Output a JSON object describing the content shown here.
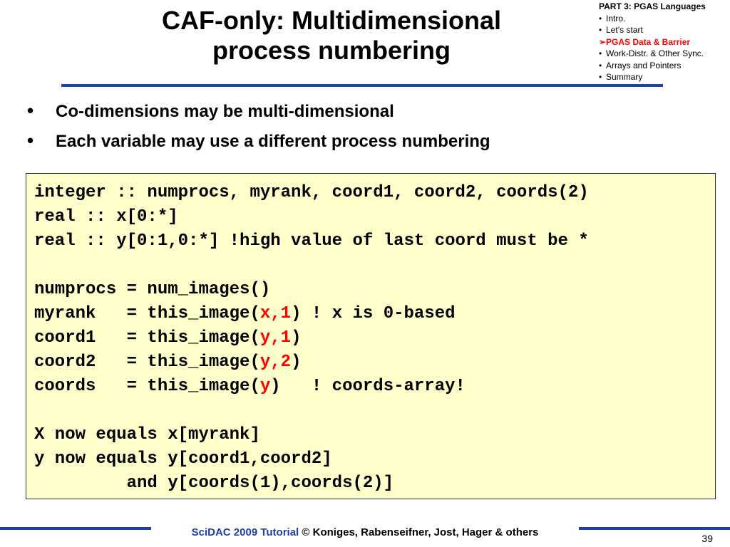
{
  "title": {
    "line1": "CAF-only:  Multidimensional",
    "line2": "process numbering"
  },
  "outline": {
    "heading": "PART 3: PGAS Languages",
    "items": [
      {
        "label": "Intro.",
        "marker": "•",
        "current": false
      },
      {
        "label": "Let’s start",
        "marker": "•",
        "current": false
      },
      {
        "label": "PGAS Data & Barrier",
        "marker": "➢",
        "current": true
      },
      {
        "label": "Work-Distr. & Other Sync.",
        "marker": "•",
        "current": false
      },
      {
        "label": "Arrays and Pointers",
        "marker": "•",
        "current": false
      },
      {
        "label": "Summary",
        "marker": "•",
        "current": false
      }
    ]
  },
  "bullets": [
    "Co-dimensions may be multi-dimensional",
    "Each variable may use a different process numbering"
  ],
  "code": {
    "line1": "integer :: numprocs, myrank, coord1, coord2, coords(2)",
    "line2": "real :: x[0:*]",
    "line3": "real :: y[0:1,0:*] !high value of last coord must be *",
    "line5": "numprocs = num_images()",
    "line6": {
      "pre": "myrank   = this_image(",
      "hl": "x,1",
      "post": ") ! x is 0-based"
    },
    "line7": {
      "pre": "coord1   = this_image(",
      "hl": "y,1",
      "post": ")"
    },
    "line8": {
      "pre": "coord2   = this_image(",
      "hl": "y,2",
      "post": ")"
    },
    "line9": {
      "pre": "coords   = this_image(",
      "hl": "y",
      "post": ")   ! coords-array!"
    },
    "line11": "X now equals x[myrank]",
    "line12": "y now equals y[coord1,coord2]",
    "line13": "         and y[coords(1),coords(2)]"
  },
  "footer": {
    "brand": "SciDAC 2009 Tutorial",
    "rest": " © Koniges, Rabenseifner, Jost, Hager & others",
    "page_number": "39"
  },
  "colors": {
    "accent_blue": "#1f3fa8",
    "highlight_red": "#ff0000",
    "code_background": "#ffffcc"
  }
}
